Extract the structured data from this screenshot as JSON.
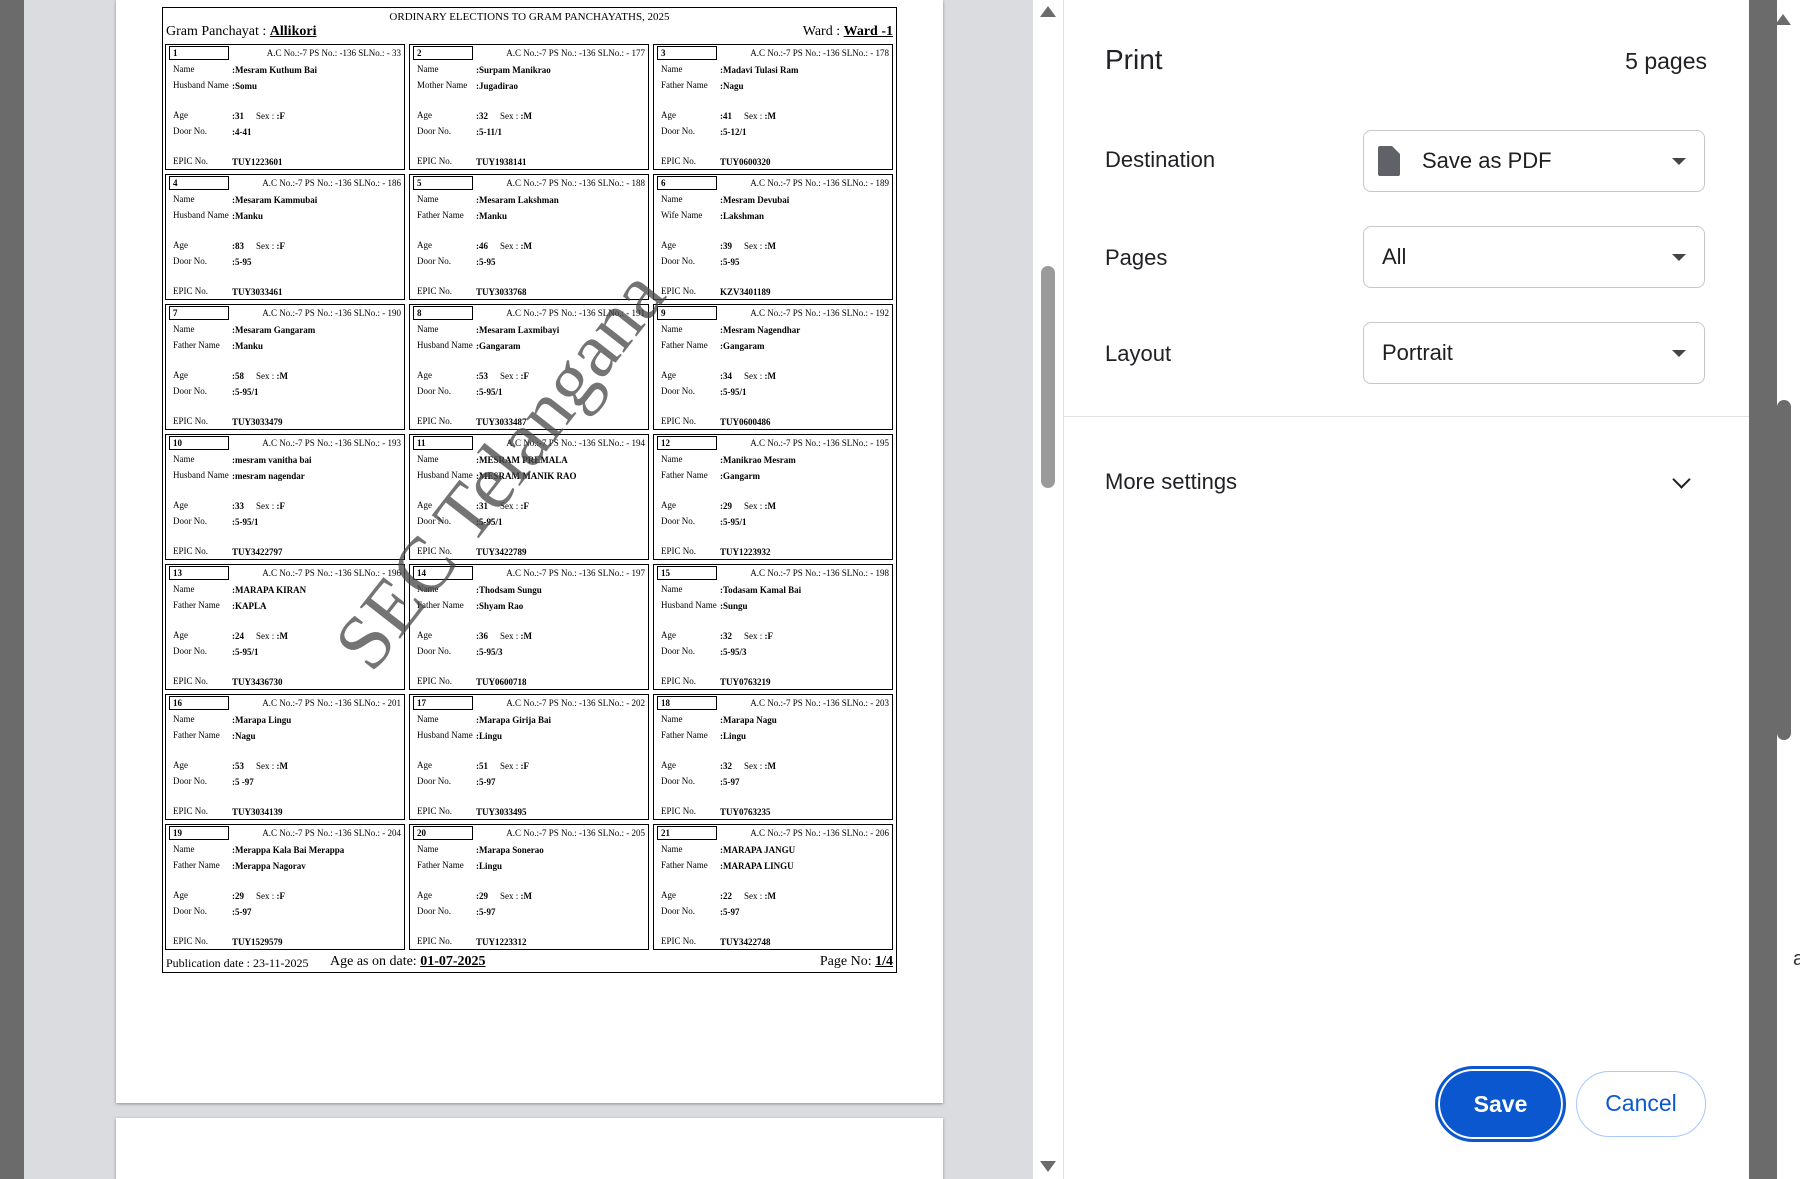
{
  "dialog": {
    "title": "Print",
    "pages_count": "5 pages",
    "destination_label": "Destination",
    "destination_value": "Save as PDF",
    "pages_label": "Pages",
    "pages_value": "All",
    "layout_label": "Layout",
    "layout_value": "Portrait",
    "more_settings": "More settings",
    "save": "Save",
    "cancel": "Cancel"
  },
  "doc": {
    "heading": "ORDINARY ELECTIONS TO GRAM PANCHAYATHS, 2025",
    "gp_label": "Gram Panchayat : ",
    "gp_value": "Allikori",
    "ward_label": "Ward : ",
    "ward_value": "Ward -1",
    "pub_date": "Publication date : 23-11-2025",
    "age_label": "Age as on date: ",
    "age_date": "01-07-2025",
    "page_label": "Page No: ",
    "page_value": "1/4",
    "watermark": "SEC Telangana",
    "cards": [
      {
        "serial": "1",
        "hdr": "A.C No.:-7 PS No.: -136 SLNo.: - 33",
        "name": ":Mesram Kuthum Bai",
        "rel_label": "Husband Name",
        "rel": ":Somu",
        "age": ":31",
        "sex": ":F",
        "door": ":4-41",
        "epic": "TUY1223601"
      },
      {
        "serial": "2",
        "hdr": "A.C No.:-7 PS No.: -136 SLNo.: - 177",
        "name": ":Surpam Manikrao",
        "rel_label": "Mother Name",
        "rel": ":Jugadirao",
        "age": ":32",
        "sex": ":M",
        "door": ":5-11/1",
        "epic": "TUY1938141"
      },
      {
        "serial": "3",
        "hdr": "A.C No.:-7 PS No.: -136 SLNo.: - 178",
        "name": ":Madavi Tulasi Ram",
        "rel_label": "Father Name",
        "rel": ":Nagu",
        "age": ":41",
        "sex": ":M",
        "door": ":5-12/1",
        "epic": "TUY0600320"
      },
      {
        "serial": "4",
        "hdr": "A.C No.:-7 PS No.: -136 SLNo.: - 186",
        "name": ":Mesaram Kammubai",
        "rel_label": "Husband Name",
        "rel": ":Manku",
        "age": ":83",
        "sex": ":F",
        "door": ":5-95",
        "epic": "TUY3033461"
      },
      {
        "serial": "5",
        "hdr": "A.C No.:-7 PS No.: -136 SLNo.: - 188",
        "name": ":Mesaram Lakshman",
        "rel_label": "Father Name",
        "rel": ":Manku",
        "age": ":46",
        "sex": ":M",
        "door": ":5-95",
        "epic": "TUY3033768"
      },
      {
        "serial": "6",
        "hdr": "A.C No.:-7 PS No.: -136 SLNo.: - 189",
        "name": ":Mesram Devubai",
        "rel_label": "Wife Name",
        "rel": ":Lakshman",
        "age": ":39",
        "sex": ":M",
        "door": ":5-95",
        "epic": "KZV3401189"
      },
      {
        "serial": "7",
        "hdr": "A.C No.:-7 PS No.: -136 SLNo.: - 190",
        "name": ":Mesaram Gangaram",
        "rel_label": "Father Name",
        "rel": ":Manku",
        "age": ":58",
        "sex": ":M",
        "door": ":5-95/1",
        "epic": "TUY3033479"
      },
      {
        "serial": "8",
        "hdr": "A.C No.:-7 PS No.: -136 SLNo.: - 191",
        "name": ":Mesaram Laxmibayi",
        "rel_label": "Husband Name",
        "rel": ":Gangaram",
        "age": ":53",
        "sex": ":F",
        "door": ":5-95/1",
        "epic": "TUY3033487"
      },
      {
        "serial": "9",
        "hdr": "A.C No.:-7 PS No.: -136 SLNo.: - 192",
        "name": ":Mesram Nagendhar",
        "rel_label": "Father Name",
        "rel": ":Gangaram",
        "age": ":34",
        "sex": ":M",
        "door": ":5-95/1",
        "epic": "TUY0600486"
      },
      {
        "serial": "10",
        "hdr": "A.C No.:-7 PS No.: -136 SLNo.: - 193",
        "name": ":mesram vanitha bai",
        "rel_label": "Husband Name",
        "rel": ":mesram nagendar",
        "age": ":33",
        "sex": ":F",
        "door": ":5-95/1",
        "epic": "TUY3422797"
      },
      {
        "serial": "11",
        "hdr": "A.C No.:-7 PS No.: -136 SLNo.: - 194",
        "name": ":MESRAM PREMALA",
        "rel_label": "Husband Name",
        "rel": ":MESRAM MANIK RAO",
        "age": ":31",
        "sex": ":F",
        "door": ":5-95/1",
        "epic": "TUY3422789"
      },
      {
        "serial": "12",
        "hdr": "A.C No.:-7 PS No.: -136 SLNo.: - 195",
        "name": ":Manikrao Mesram",
        "rel_label": "Father Name",
        "rel": ":Gangarm",
        "age": ":29",
        "sex": ":M",
        "door": ":5-95/1",
        "epic": "TUY1223932"
      },
      {
        "serial": "13",
        "hdr": "A.C No.:-7 PS No.: -136 SLNo.: - 196",
        "name": ":MARAPA KIRAN",
        "rel_label": "Father Name",
        "rel": ":KAPLA",
        "age": ":24",
        "sex": ":M",
        "door": ":5-95/1",
        "epic": "TUY3436730"
      },
      {
        "serial": "14",
        "hdr": "A.C No.:-7 PS No.: -136 SLNo.: - 197",
        "name": ":Thodsam Sungu",
        "rel_label": "Father Name",
        "rel": ":Shyam Rao",
        "age": ":36",
        "sex": ":M",
        "door": ":5-95/3",
        "epic": "TUY0600718"
      },
      {
        "serial": "15",
        "hdr": "A.C No.:-7 PS No.: -136 SLNo.: - 198",
        "name": ":Todasam Kamal Bai",
        "rel_label": "Husband Name",
        "rel": ":Sungu",
        "age": ":32",
        "sex": ":F",
        "door": ":5-95/3",
        "epic": "TUY0763219"
      },
      {
        "serial": "16",
        "hdr": "A.C No.:-7 PS No.: -136 SLNo.: - 201",
        "name": ":Marapa Lingu",
        "rel_label": "Father Name",
        "rel": ":Nagu",
        "age": ":53",
        "sex": ":M",
        "door": ":5 -97",
        "epic": "TUY3034139"
      },
      {
        "serial": "17",
        "hdr": "A.C No.:-7 PS No.: -136 SLNo.: - 202",
        "name": ":Marapa Girija Bai",
        "rel_label": "Husband Name",
        "rel": ":Lingu",
        "age": ":51",
        "sex": ":F",
        "door": ":5-97",
        "epic": "TUY3033495"
      },
      {
        "serial": "18",
        "hdr": "A.C No.:-7 PS No.: -136 SLNo.: - 203",
        "name": ":Marapa Nagu",
        "rel_label": "Father Name",
        "rel": ":Lingu",
        "age": ":32",
        "sex": ":M",
        "door": ":5-97",
        "epic": "TUY0763235"
      },
      {
        "serial": "19",
        "hdr": "A.C No.:-7 PS No.: -136 SLNo.: - 204",
        "name": ":Merappa Kala Bai Merappa",
        "rel_label": "Father Name",
        "rel": ":Merappa Nagorav",
        "age": ":29",
        "sex": ":F",
        "door": ":5-97",
        "epic": "TUY1529579"
      },
      {
        "serial": "20",
        "hdr": "A.C No.:-7 PS No.: -136 SLNo.: - 205",
        "name": ":Marapa Sonerao",
        "rel_label": "Father Name",
        "rel": ":Lingu",
        "age": ":29",
        "sex": ":M",
        "door": ":5-97",
        "epic": "TUY1223312"
      },
      {
        "serial": "21",
        "hdr": "A.C No.:-7 PS No.: -136 SLNo.: - 206",
        "name": ":MARAPA JANGU",
        "rel_label": "Father Name",
        "rel": ":MARAPA LINGU",
        "age": ":22",
        "sex": ":M",
        "door": ":5-97",
        "epic": "TUY3422748"
      }
    ],
    "field_labels": {
      "name": "Name",
      "age": "Age",
      "sex": "Sex : ",
      "door": "Door No.",
      "epic": "EPIC No."
    }
  },
  "right_edge_text": "a",
  "colors": {
    "accent": "#0b57d0",
    "preview_bg": "#dadce0",
    "scrollbar": "#6b6b6b"
  }
}
